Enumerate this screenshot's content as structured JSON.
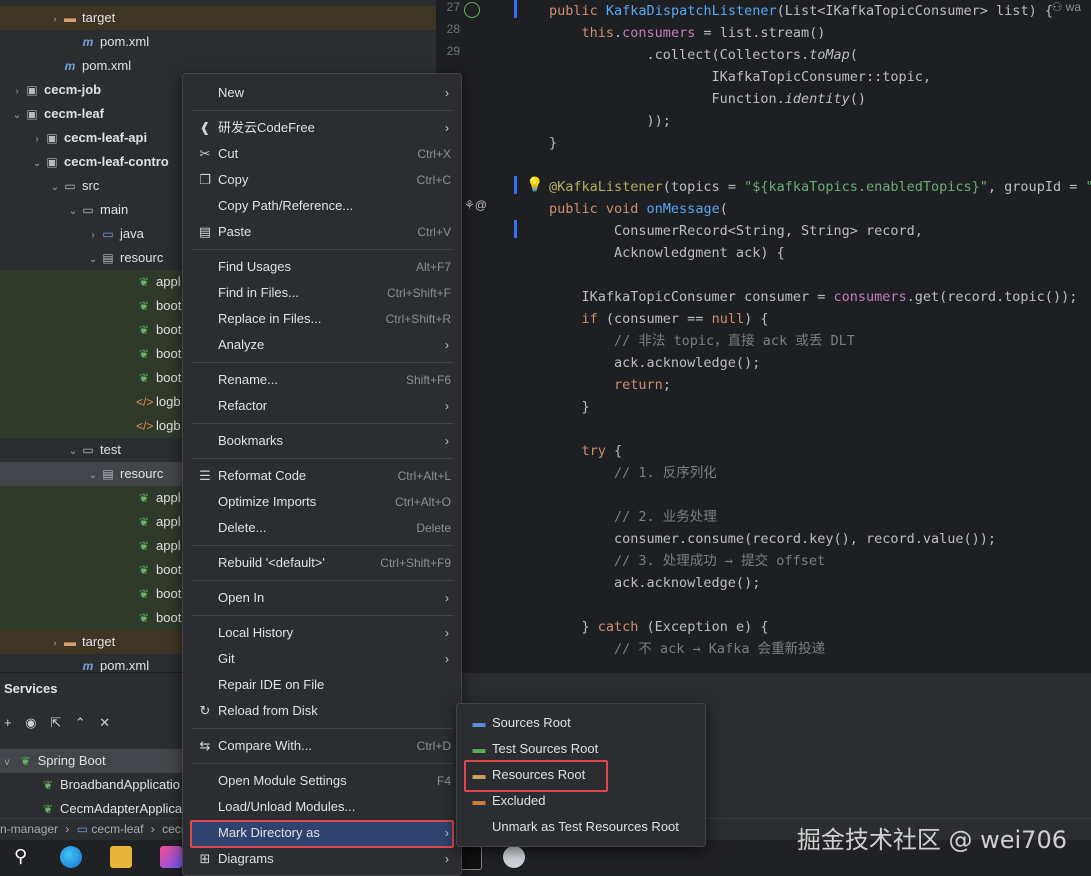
{
  "tree": {
    "rows": [
      {
        "label": "target",
        "icon": "folder-orange-icon",
        "arrow": ">",
        "indent": 62
      },
      {
        "label": "pom.xml",
        "icon": "maven-icon",
        "arrow": "",
        "indent": 80
      },
      {
        "label": "pom.xml",
        "icon": "maven-icon",
        "arrow": "",
        "indent": 62
      },
      {
        "label": "cecm-job",
        "icon": "module-folder-icon",
        "arrow": ">",
        "indent": 24
      },
      {
        "label": "cecm-leaf",
        "icon": "module-folder-icon",
        "arrow": "v",
        "indent": 24
      },
      {
        "label": "cecm-leaf-api",
        "icon": "module-folder-icon",
        "arrow": ">",
        "indent": 44
      },
      {
        "label": "cecm-leaf-contro",
        "icon": "module-folder-icon",
        "arrow": "v",
        "indent": 44
      },
      {
        "label": "src",
        "icon": "folder-icon",
        "arrow": "v",
        "indent": 62
      },
      {
        "label": "main",
        "icon": "folder-icon",
        "arrow": "v",
        "indent": 80
      },
      {
        "label": "java",
        "icon": "folder-blue-icon",
        "arrow": ">",
        "indent": 100
      },
      {
        "label": "resourc",
        "icon": "resources-folder-icon",
        "arrow": "v",
        "indent": 100
      },
      {
        "label": "appl",
        "icon": "spring-leaf-icon",
        "arrow": "",
        "indent": 136
      },
      {
        "label": "boot",
        "icon": "spring-leaf-icon",
        "arrow": "",
        "indent": 136
      },
      {
        "label": "boot",
        "icon": "spring-leaf-icon",
        "arrow": "",
        "indent": 136
      },
      {
        "label": "boot",
        "icon": "spring-leaf-icon",
        "arrow": "",
        "indent": 136
      },
      {
        "label": "boot",
        "icon": "spring-leaf-icon",
        "arrow": "",
        "indent": 136
      },
      {
        "label": "logb",
        "icon": "xml-icon",
        "arrow": "",
        "indent": 136
      },
      {
        "label": "logb",
        "icon": "xml-icon",
        "arrow": "",
        "indent": 136
      },
      {
        "label": "test",
        "icon": "folder-icon",
        "arrow": "v",
        "indent": 80
      },
      {
        "label": "resourc",
        "icon": "resources-folder-icon",
        "arrow": "v",
        "indent": 100
      },
      {
        "label": "appl",
        "icon": "spring-leaf-icon",
        "arrow": "",
        "indent": 136
      },
      {
        "label": "appl",
        "icon": "spring-leaf-icon",
        "arrow": "",
        "indent": 136
      },
      {
        "label": "appl",
        "icon": "spring-leaf-icon",
        "arrow": "",
        "indent": 136
      },
      {
        "label": "boot",
        "icon": "spring-leaf-icon",
        "arrow": "",
        "indent": 136
      },
      {
        "label": "boot",
        "icon": "spring-leaf-icon",
        "arrow": "",
        "indent": 136
      },
      {
        "label": "boot",
        "icon": "spring-leaf-icon",
        "arrow": "",
        "indent": 136
      },
      {
        "label": "target",
        "icon": "folder-orange-icon",
        "arrow": ">",
        "indent": 62
      },
      {
        "label": "pom.xml",
        "icon": "maven-icon",
        "arrow": "",
        "indent": 80
      }
    ]
  },
  "editor": {
    "line_numbers": [
      "27",
      "28",
      "29"
    ],
    "author_hint": "wa"
  },
  "services": {
    "title": "Services",
    "toolbar": [
      "+",
      "◉",
      "⇱",
      "⌃",
      "✕"
    ],
    "items": [
      "Spring Boot",
      "BroadbandApplicatio",
      "CecmAdapterApplica"
    ]
  },
  "status": {
    "crumbs": [
      "n-manager",
      "cecm-leaf",
      "cecm-leaf-controller"
    ]
  },
  "menu": {
    "items": [
      {
        "label": "New",
        "shortcut": "",
        "submenu": true,
        "icon": ""
      },
      {
        "sep": true
      },
      {
        "label": "研发云CodeFree",
        "shortcut": "",
        "submenu": true,
        "icon": "codefree-icon"
      },
      {
        "label": "Cut",
        "shortcut": "Ctrl+X",
        "submenu": false,
        "icon": "cut-icon"
      },
      {
        "label": "Copy",
        "shortcut": "Ctrl+C",
        "submenu": false,
        "icon": "copy-icon"
      },
      {
        "label": "Copy Path/Reference...",
        "shortcut": "",
        "submenu": false,
        "icon": ""
      },
      {
        "label": "Paste",
        "shortcut": "Ctrl+V",
        "submenu": false,
        "icon": "paste-icon"
      },
      {
        "sep": true
      },
      {
        "label": "Find Usages",
        "shortcut": "Alt+F7",
        "submenu": false,
        "icon": ""
      },
      {
        "label": "Find in Files...",
        "shortcut": "Ctrl+Shift+F",
        "submenu": false,
        "icon": ""
      },
      {
        "label": "Replace in Files...",
        "shortcut": "Ctrl+Shift+R",
        "submenu": false,
        "icon": ""
      },
      {
        "label": "Analyze",
        "shortcut": "",
        "submenu": true,
        "icon": ""
      },
      {
        "sep": true
      },
      {
        "label": "Rename...",
        "shortcut": "Shift+F6",
        "submenu": false,
        "icon": ""
      },
      {
        "label": "Refactor",
        "shortcut": "",
        "submenu": true,
        "icon": ""
      },
      {
        "sep": true
      },
      {
        "label": "Bookmarks",
        "shortcut": "",
        "submenu": true,
        "icon": ""
      },
      {
        "sep": true
      },
      {
        "label": "Reformat Code",
        "shortcut": "Ctrl+Alt+L",
        "submenu": false,
        "icon": "reformat-icon"
      },
      {
        "label": "Optimize Imports",
        "shortcut": "Ctrl+Alt+O",
        "submenu": false,
        "icon": ""
      },
      {
        "label": "Delete...",
        "shortcut": "Delete",
        "submenu": false,
        "icon": ""
      },
      {
        "sep": true
      },
      {
        "label": "Rebuild '<default>'",
        "shortcut": "Ctrl+Shift+F9",
        "submenu": false,
        "icon": ""
      },
      {
        "sep": true
      },
      {
        "label": "Open In",
        "shortcut": "",
        "submenu": true,
        "icon": ""
      },
      {
        "sep": true
      },
      {
        "label": "Local History",
        "shortcut": "",
        "submenu": true,
        "icon": ""
      },
      {
        "label": "Git",
        "shortcut": "",
        "submenu": true,
        "icon": ""
      },
      {
        "label": "Repair IDE on File",
        "shortcut": "",
        "submenu": false,
        "icon": ""
      },
      {
        "label": "Reload from Disk",
        "shortcut": "",
        "submenu": false,
        "icon": "reload-icon"
      },
      {
        "sep": true
      },
      {
        "label": "Compare With...",
        "shortcut": "Ctrl+D",
        "submenu": false,
        "icon": "compare-icon"
      },
      {
        "sep": true
      },
      {
        "label": "Open Module Settings",
        "shortcut": "F4",
        "submenu": false,
        "icon": ""
      },
      {
        "label": "Load/Unload Modules...",
        "shortcut": "",
        "submenu": false,
        "icon": ""
      },
      {
        "label": "Mark Directory as",
        "shortcut": "",
        "submenu": true,
        "icon": "",
        "active": true
      },
      {
        "label": "Diagrams",
        "shortcut": "",
        "submenu": true,
        "icon": "diagram-icon"
      }
    ]
  },
  "submenu": {
    "items": [
      {
        "label": "Sources Root",
        "icon": "folder-blue-icon",
        "color": "#5a8fd6"
      },
      {
        "label": "Test Sources Root",
        "icon": "folder-green-icon",
        "color": "#5fa65f"
      },
      {
        "label": "Resources Root",
        "icon": "resources-root-icon",
        "color": "#c9a35b"
      },
      {
        "label": "Excluded",
        "icon": "folder-orange-icon",
        "color": "#c9803f"
      },
      {
        "label": "Unmark as Test Resources Root",
        "icon": "",
        "color": ""
      }
    ]
  },
  "watermark": "掘金技术社区 @ wei706",
  "colors": {
    "highlight_box": "#e0474c",
    "selection": "#2e436e"
  }
}
